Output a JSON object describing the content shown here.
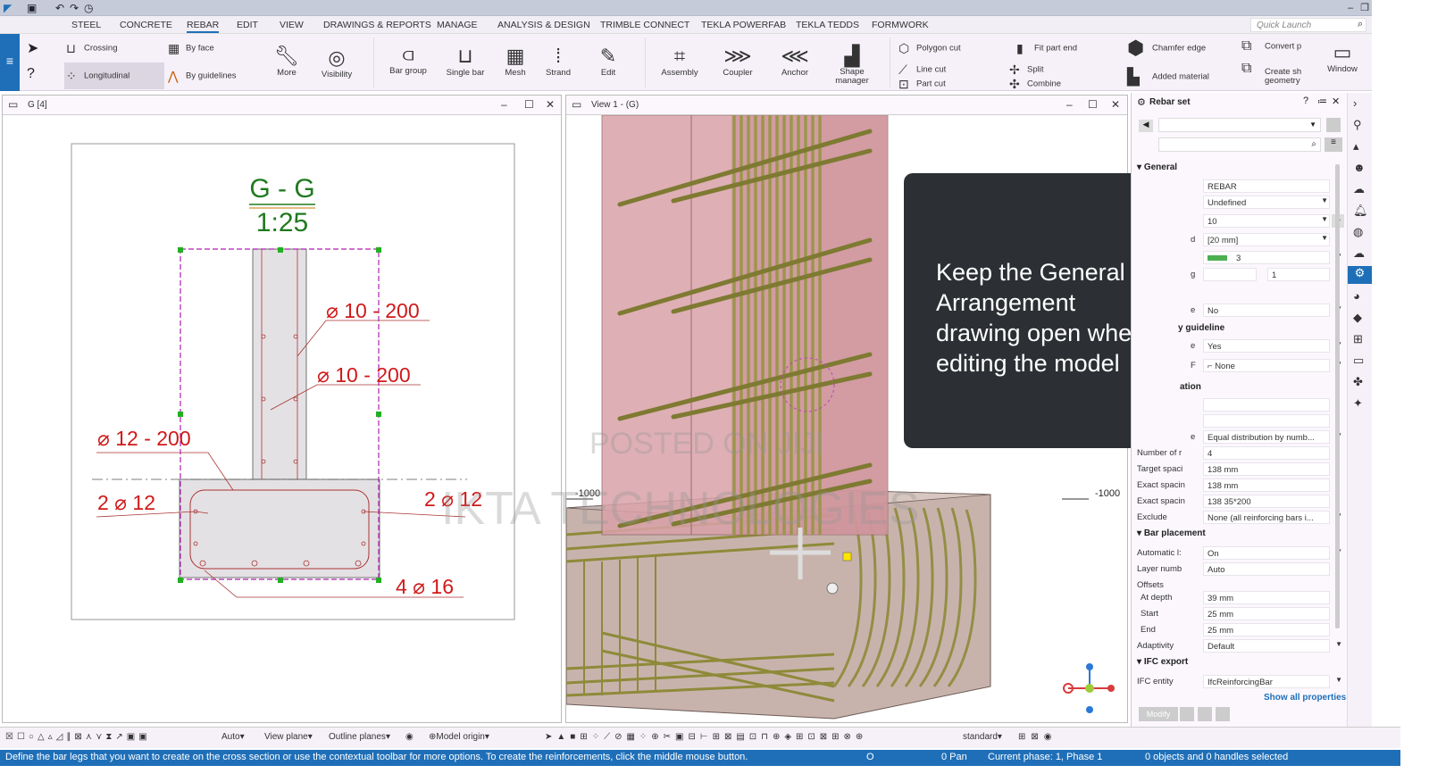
{
  "menu": {
    "items": [
      "STEEL",
      "CONCRETE",
      "REBAR",
      "EDIT",
      "VIEW",
      "DRAWINGS & REPORTS",
      "MANAGE",
      "ANALYSIS & DESIGN",
      "TRIMBLE CONNECT",
      "TEKLA POWERFAB",
      "TEKLA TEDDS",
      "FORMWORK"
    ],
    "active": "REBAR",
    "quick_launch_placeholder": "Quick Launch"
  },
  "ribbon": {
    "crossing": "Crossing",
    "longitudinal": "Longitudinal",
    "by_face": "By face",
    "by_guidelines": "By guidelines",
    "more": "More",
    "visibility": "Visibility",
    "bar_group": "Bar group",
    "single_bar": "Single bar",
    "mesh": "Mesh",
    "strand": "Strand",
    "edit": "Edit",
    "assembly": "Assembly",
    "coupler": "Coupler",
    "anchor": "Anchor",
    "shape_manager": "Shape manager",
    "polygon_cut": "Polygon cut",
    "line_cut": "Line cut",
    "part_cut": "Part cut",
    "fit_part_end": "Fit part end",
    "split": "Split",
    "combine": "Combine",
    "chamfer_edge": "Chamfer edge",
    "added_material": "Added material",
    "convert": "Convert p",
    "create_geometry_1": "Create sh",
    "create_geometry_2": "geometry",
    "window": "Window"
  },
  "drawing_panel": {
    "title": "G  [4]",
    "section_title": "G - G",
    "scale": "1:25",
    "labels": [
      "⌀ 10 - 200",
      "⌀ 10 - 200",
      "⌀ 12 - 200",
      "2 ⌀ 12",
      "2 ⌀ 12",
      "4 ⌀ 16"
    ]
  },
  "view_panel": {
    "title": "View 1 - (G)",
    "dim_left": "-1000",
    "dim_right": "-1000"
  },
  "overlay_text": "Keep the General Arrangement drawing open when editing the model",
  "watermarks": {
    "line1": "POSTED ON JIJI",
    "line2": "IKTA TECHNOLOGIES"
  },
  "properties": {
    "title": "Rebar set",
    "general": "General",
    "name": "REBAR",
    "grade": "Undefined",
    "size": "10",
    "bend_radius": "[20 mm]",
    "class": "3",
    "number_field": "1",
    "lbl_d": "d",
    "lbl_g": "g",
    "lbl_e": "e",
    "lbl_e2": "e",
    "lbl_f": "F",
    "lbl_e3": "e",
    "no_value": "No",
    "guideline": "y guideline",
    "yes": "Yes",
    "none": "None",
    "ation": "ation",
    "spacing_type": "Equal distribution by numb...",
    "number_label": "Number of r",
    "number_value": "4",
    "target_label": "Target spaci",
    "target_value": "138 mm",
    "exact_label": "Exact spacin",
    "exact_value": "138 mm",
    "exact2_label": "Exact spacin",
    "exact2_value": "138 35*200",
    "exclude_label": "Exclude",
    "exclude_value": "None (all reinforcing bars i...",
    "bar_placement": "Bar placement",
    "automatic_label": "Automatic l:",
    "automatic_value": "On",
    "layer_label": "Layer numb",
    "layer_value": "Auto",
    "offsets": "Offsets",
    "depth_label": "At depth",
    "depth_value": "39 mm",
    "start_label": "Start",
    "start_value": "25 mm",
    "end_label": "End",
    "end_value": "25 mm",
    "adaptivity_label": "Adaptivity",
    "adaptivity_value": "Default",
    "ifc_export": "IFC export",
    "ifc_label": "IFC entity",
    "ifc_value": "IfcReinforcingBar",
    "show_all": "Show all properties",
    "modify": "Modify"
  },
  "toolbar_bottom": {
    "auto": "Auto",
    "view_plane": "View plane",
    "outline_planes": "Outline planes",
    "model_origin": "Model origin",
    "standard": "standard"
  },
  "status": {
    "message": "Define the bar legs that you want to create on the cross section or use the contextual toolbar for more options. To create the reinforcements, click the middle mouse button.",
    "o": "O",
    "pan": "0 Pan",
    "phase": "Current phase: 1, Phase 1",
    "selection": "0 objects and 0 handles selected"
  },
  "colors": {
    "accent": "#1f6fb8",
    "drawing_green": "#1f7a1f",
    "rebar_red": "#d01919",
    "column_pink": "#d9a2a8",
    "rebar_olive": "#8e8a3a"
  }
}
